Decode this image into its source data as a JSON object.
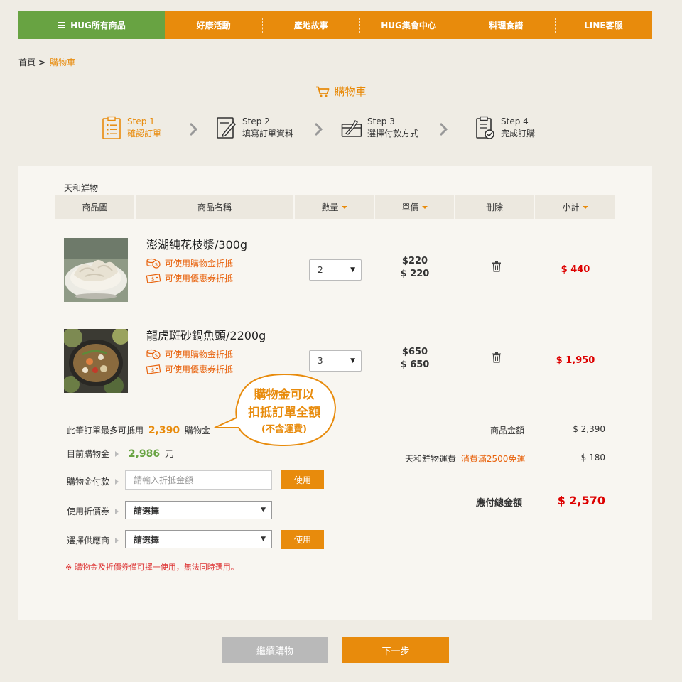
{
  "nav": {
    "main": "HUG所有商品",
    "items": [
      "好康活動",
      "產地故事",
      "HUG集會中心",
      "料理食譜",
      "LINE客服"
    ]
  },
  "breadcrumb": {
    "home": "首頁",
    "separator": ">",
    "current": "購物車"
  },
  "page_title": "購物車",
  "steps": [
    {
      "label": "Step 1",
      "desc": "確認訂單"
    },
    {
      "label": "Step 2",
      "desc": "填寫訂單資料"
    },
    {
      "label": "Step 3",
      "desc": "選擇付款方式"
    },
    {
      "label": "Step 4",
      "desc": "完成訂購"
    }
  ],
  "cart": {
    "vendor": "天和鮮物",
    "headers": {
      "image": "商品圖",
      "name": "商品名稱",
      "qty": "數量",
      "price": "單價",
      "delete": "刪除",
      "subtotal": "小計"
    },
    "items": [
      {
        "name": "澎湖純花枝漿/300g",
        "tag_points": "可使用購物金折抵",
        "tag_coupon": "可使用優惠券折抵",
        "qty": "2",
        "old_price": "$220",
        "price": "$ 220",
        "subtotal": "$ 440"
      },
      {
        "name": "龍虎斑砂鍋魚頭/2200g",
        "tag_points": "可使用購物金折抵",
        "tag_coupon": "可使用優惠券折抵",
        "qty": "3",
        "old_price": "$650",
        "price": "$ 650",
        "subtotal": "$ 1,950"
      }
    ]
  },
  "discount": {
    "max_prefix": "此筆訂單最多可抵用",
    "max_value": "2,390",
    "max_suffix": "購物金",
    "current_label": "目前購物金",
    "current_value": "2,986",
    "current_unit": "元",
    "points_label": "購物金付款",
    "points_placeholder": "請輸入折抵金額",
    "use_label": "使用",
    "coupon_label": "使用折價券",
    "coupon_value": "請選擇",
    "supplier_label": "選擇供應商",
    "supplier_value": "請選擇",
    "notice": "※ 購物金及折價券僅可擇一使用，無法同時選用。"
  },
  "bubble": {
    "line1": "購物金可以",
    "line2": "扣抵訂單全額",
    "line3": "(不含運費)"
  },
  "summary": {
    "goods_label": "商品金額",
    "goods_value": "$ 2,390",
    "shipping_label": "天和鮮物運費",
    "shipping_note": "消費滿2500免運",
    "shipping_value": "$ 180",
    "total_label": "應付總金額",
    "total_value": "$ 2,570"
  },
  "buttons": {
    "continue": "繼續購物",
    "next": "下一步"
  },
  "colors": {
    "orange": "#e88b0c",
    "green": "#68a342",
    "red": "#d00000",
    "gray_button": "#b9b9b9"
  }
}
